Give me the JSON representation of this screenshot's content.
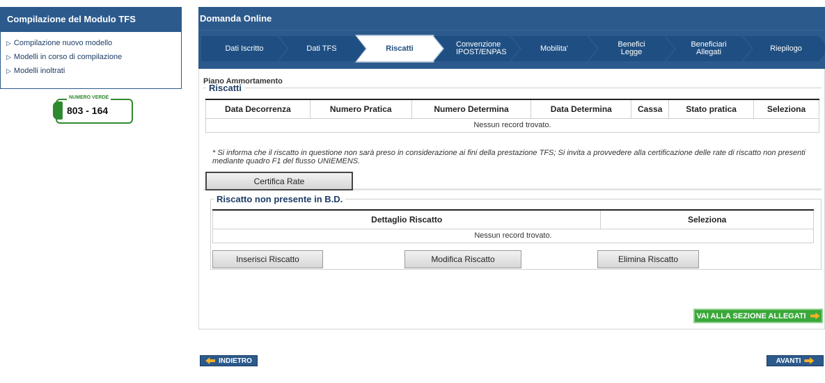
{
  "sidebar": {
    "title": "Compilazione del Modulo TFS",
    "links": [
      {
        "label": "Compilazione nuovo modello"
      },
      {
        "label": "Modelli in corso di compilazione"
      },
      {
        "label": "Modelli inoltrati"
      }
    ],
    "numero_verde": {
      "label": "NUMERO VERDE",
      "number": "803 - 164"
    }
  },
  "main": {
    "title": "Domanda Online",
    "steps": [
      {
        "label": "Dati Iscritto"
      },
      {
        "label": "Dati TFS"
      },
      {
        "label": "Riscatti"
      },
      {
        "label": "Convenzione IPOST/ENPAS"
      },
      {
        "label": "Mobilita'"
      },
      {
        "label": "Benefici Legge"
      },
      {
        "label": "Beneficiari Allegati"
      },
      {
        "label": "Riepilogo"
      }
    ],
    "active_step": "Riscatti",
    "section_label": "Piano Ammortamento",
    "riscatti": {
      "legend": "Riscatti",
      "columns": [
        "Data Decorrenza",
        "Numero Pratica",
        "Numero Determina",
        "Data Determina",
        "Cassa",
        "Stato pratica",
        "Seleziona"
      ],
      "empty_text": "Nessun record trovato.",
      "note": "* Si informa che il riscatto in questione non sarà preso in considerazione ai fini della prestazione TFS; Si invita a provvedere alla certificazione delle rate di riscatto non presenti mediante quadro F1 del flusso UNIEMENS.",
      "certifica_label": "Certifica Rate"
    },
    "non_presente": {
      "legend": "Riscatto non presente in B.D.",
      "columns": [
        "Dettaglio Riscatto",
        "Seleziona"
      ],
      "empty_text": "Nessun record trovato.",
      "inserisci_label": "Inserisci Riscatto",
      "modifica_label": "Modifica Riscatto",
      "elimina_label": "Elimina Riscatto"
    },
    "allegati_label": "VAI ALLA SEZIONE ALLEGATI"
  },
  "nav": {
    "back_label": "INDIETRO",
    "next_label": "AVANTI"
  },
  "colors": {
    "header_blue": "#2c5a8c",
    "step_blue": "#1f4f82",
    "green": "#3aa83a",
    "arrow_orange": "#f5b021"
  }
}
